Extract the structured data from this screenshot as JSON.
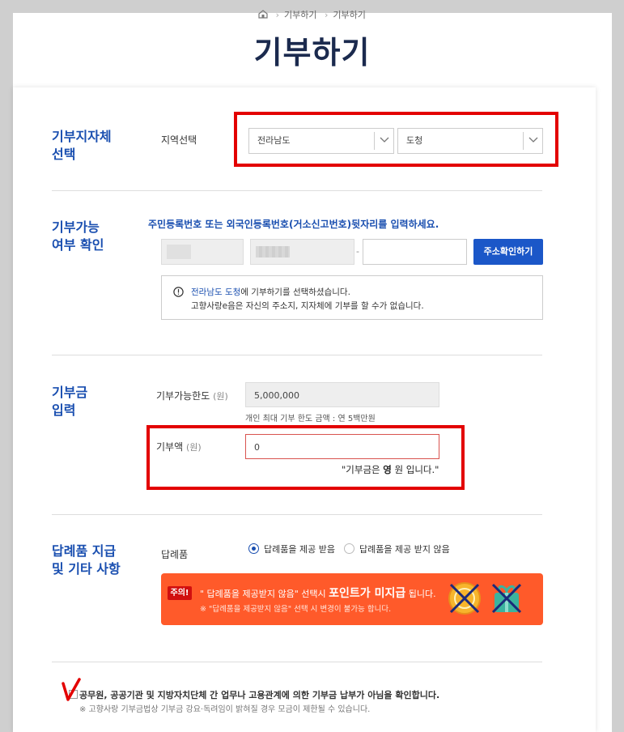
{
  "breadcrumb": {
    "items": [
      "기부하기",
      "기부하기"
    ]
  },
  "title": "기부하기",
  "section_region": {
    "title": "기부지자체\n선택",
    "label": "지역선택",
    "province_select": "전라남도",
    "office_select": "도청"
  },
  "section_eligibility": {
    "title": "기부가능\n여부 확인",
    "instruction": "주민등록번호 또는 외국인등록번호(거소신고번호)뒷자리를 입력하세요.",
    "dash": "-",
    "address_button": "주소확인하기",
    "info_highlight": "전라남도 도청",
    "info_line1_rest": "에 기부하기를 선택하셨습니다.",
    "info_line2": "고향사랑e음은 자신의 주소지, 지자체에 기부를 할 수가 없습니다."
  },
  "section_amount": {
    "title": "기부금\n입력",
    "limit_label": "기부가능한도",
    "unit": "(원)",
    "limit_value": "5,000,000",
    "limit_hint": "개인 최대 기부 한도 금액 : 연 5백만원",
    "amount_label": "기부액",
    "amount_value": "0",
    "amount_text_pre": "\"기부금은 ",
    "amount_text_bold": "영",
    "amount_text_post": " 원 입니다.\""
  },
  "section_gift": {
    "title": "답례품 지급\n및 기타 사항",
    "label": "답례품",
    "option_receive": "답례품을 제공 받음",
    "option_decline": "답례품을 제공 받지 않음",
    "selected": "답례품을 제공 받음",
    "banner_warn": "주의!",
    "banner_line1_pre": "\" 답례품을 제공받지 않음\" 선택시 ",
    "banner_line1_bold": "포인트가 미지급",
    "banner_line1_post": " 됩니다.",
    "banner_line2": "※ \"답례품을 제공받지 않음\" 선택 시 변경이 불가능 합니다."
  },
  "agreement": {
    "text": "공무원, 공공기관 및 지방자치단체 간 업무나 고용관계에 의한 기부금 납부가 아님을 확인합니다.",
    "note": "※ 고향사랑 기부금법상 기부금 강요·독려임이 밝혀질 경우 모금이 제한될 수 있습니다."
  },
  "colors": {
    "accent": "#1a4fb0",
    "button": "#1b57c8",
    "highlight": "#e30000",
    "banner": "#ff5a2a",
    "title": "#1b2a4e"
  },
  "icons": [
    "home-icon",
    "chevron-down-icon",
    "info-circle-icon",
    "coin-icon",
    "gift-icon",
    "checkmark-icon"
  ]
}
